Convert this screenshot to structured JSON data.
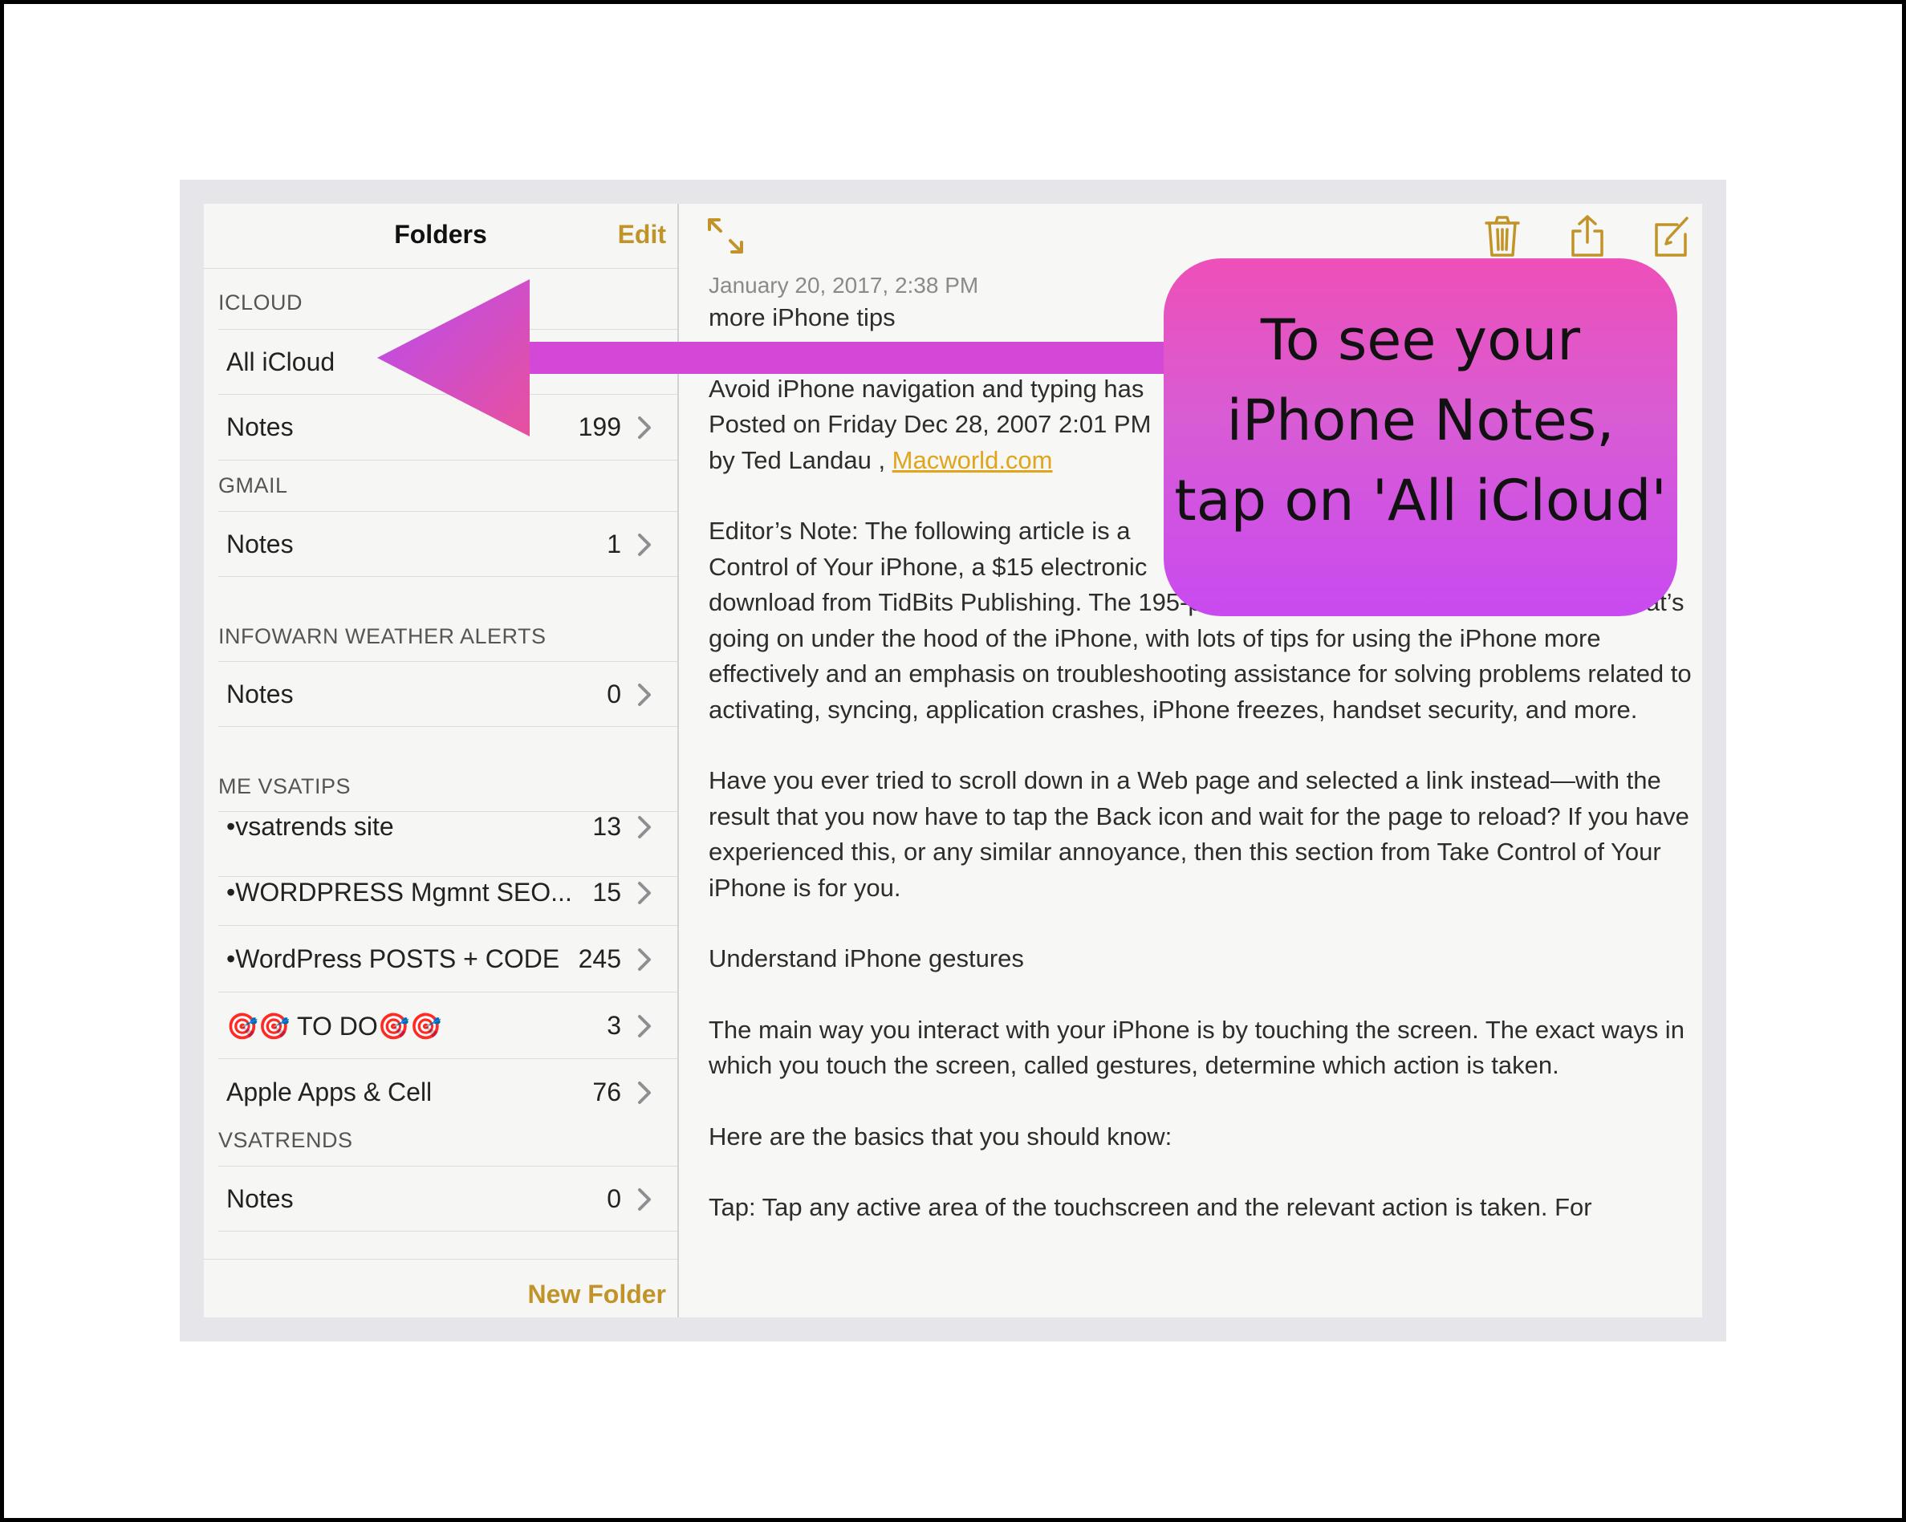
{
  "sidebar": {
    "title": "Folders",
    "edit_label": "Edit",
    "new_folder_label": "New Folder",
    "sections": {
      "icloud": {
        "header": "ICLOUD",
        "all_icloud": "All iCloud",
        "notes": {
          "label": "Notes",
          "count": "199"
        }
      },
      "gmail": {
        "header": "GMAIL",
        "notes": {
          "label": "Notes",
          "count": "1"
        }
      },
      "infowarn": {
        "header": "INFOWARN WEATHER ALERTS",
        "notes": {
          "label": "Notes",
          "count": "0"
        }
      },
      "me_vsatips": {
        "header": "ME VSATIPS",
        "items": [
          {
            "label": "•vsatrends site",
            "count": "13"
          },
          {
            "label": "•WORDPRESS Mgmnt SEO...",
            "count": "15"
          },
          {
            "label": "•WordPress POSTS + CODE",
            "count": "245"
          },
          {
            "label": "🎯🎯 TO DO🎯🎯",
            "count": "3"
          },
          {
            "label": "Apple Apps & Cell",
            "count": "76"
          }
        ]
      },
      "vsatrends": {
        "header": "VSATRENDS",
        "notes": {
          "label": "Notes",
          "count": "0"
        }
      }
    }
  },
  "toolbar": {
    "icons": [
      "expand-icon",
      "trash-icon",
      "share-icon",
      "compose-icon"
    ],
    "accent_color": "#c1942a"
  },
  "note": {
    "date": "January 20, 2017, 2:38 PM",
    "title": "more iPhone tips",
    "line1": "Avoid iPhone navigation and typing has",
    "line2": "Posted on Friday Dec 28, 2007 2:01 PM",
    "byline_prefix": "by Ted Landau , ",
    "byline_link": "Macworld.com",
    "para1": "Editor’s Note: The following article is a\nControl of Your iPhone, a $15 electronic                                                              for\ndownload from TidBits Publishing. The 195-page ebook helps readers understand what’s going on under the hood of the iPhone, with lots of tips for using the iPhone more effectively and an emphasis on troubleshooting assistance for solving problems related to activating, syncing, application crashes, iPhone freezes, handset security, and more.",
    "para2": "Have you ever tried to scroll down in a Web page and selected a link instead—with the result that you now have to tap the Back icon and wait for the page to reload? If you have experienced this, or any similar annoyance, then this section from Take Control of Your iPhone is for you.",
    "heading": "Understand iPhone gestures",
    "para3": "The main way you interact with your iPhone is by touching the screen. The exact ways in which you touch the screen, called gestures, determine which action is taken.",
    "para4": "Here are the basics that you should know:",
    "para5": "Tap: Tap any active area of the touchscreen and the relevant action is taken. For"
  },
  "callout": {
    "text": "To see your\niPhone Notes,\ntap on 'All iCloud'",
    "gradient_top": "#ee4fb8",
    "gradient_bottom": "#c84af0",
    "arrow_color": "#d448d8"
  }
}
